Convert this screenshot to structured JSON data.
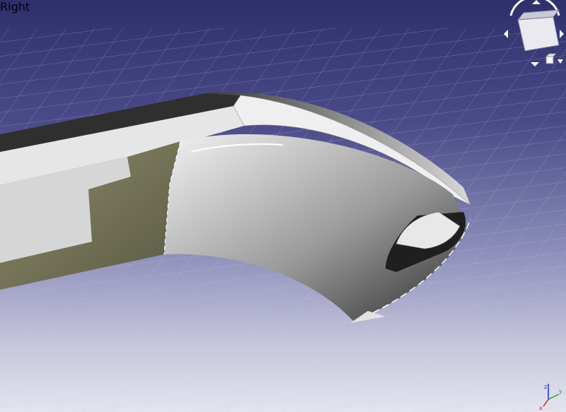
{
  "navigation_cube": {
    "face_label": "Right",
    "arrows": [
      "rotate-up-arrow",
      "rotate-down-arrow",
      "rotate-left-arrow",
      "rotate-right-arrow"
    ],
    "menu_icon": "view-menu-icon",
    "cube_icon": "mini-cube-icon"
  },
  "axis_indicator": {
    "labels": [
      "z",
      "y",
      "x"
    ],
    "colors": {
      "x": "#d02020",
      "y": "#20a020",
      "z": "#2030d0"
    }
  },
  "colors": {
    "background_top": "#2e2f6b",
    "background_bottom": "#e4e4ee",
    "grid": "#c8c8e0",
    "model_light": "#e9e9e9",
    "model_dark": "#303030",
    "model_face_olive": "#7b7a5a"
  }
}
